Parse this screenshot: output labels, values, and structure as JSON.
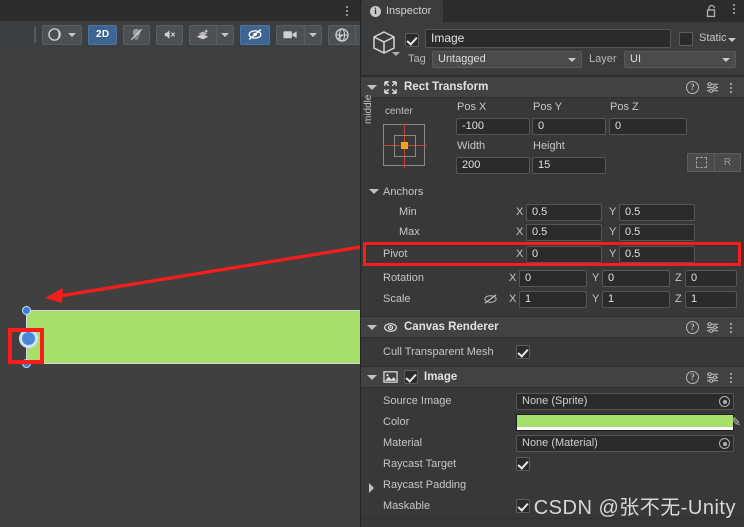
{
  "scene": {
    "tab_menu_icon": "kebab-menu-icon",
    "toolbar": {
      "draw_mode": {
        "icon": "shading-mode-icon",
        "label": "",
        "has_dropdown": true
      },
      "view_2d": {
        "label": "2D",
        "active": true
      },
      "lighting": {
        "icon": "light-off-icon",
        "active": false
      },
      "audio": {
        "icon": "audio-mute-icon",
        "active": false
      },
      "effects": {
        "icon": "fx-icon",
        "has_dropdown": true,
        "active": false
      },
      "gizmos_visibility": {
        "icon": "eye-crossed-icon",
        "active": true
      },
      "camera": {
        "icon": "camera-icon",
        "has_dropdown": true,
        "active": false
      },
      "gizmos": {
        "icon": "gizmo-globe-icon",
        "has_dropdown": true,
        "active": false
      }
    },
    "selection": {
      "rect_fill_color": "#a6e06a",
      "pivot_handle_color": "#4a87d6",
      "handle_color": "#3d7fd1",
      "annotation_color": "#fb1c1c"
    }
  },
  "inspector": {
    "tab": {
      "label": "Inspector",
      "icon": "info-icon"
    },
    "lock_icon": "lock-open-icon",
    "menu_icon": "kebab-menu-icon",
    "gameobject": {
      "icon": "prefab-cube-icon",
      "enabled": true,
      "name": "Image",
      "static_label": "Static",
      "static_checked": false,
      "tag_label": "Tag",
      "tag_value": "Untagged",
      "layer_label": "Layer",
      "layer_value": "UI"
    },
    "components": [
      {
        "title": "Rect Transform",
        "icon": "rect-transform-icon",
        "expanded": true,
        "anchor_preset": {
          "horizontal": "center",
          "vertical": "middle"
        },
        "pos": {
          "labels": [
            "Pos X",
            "Pos Y",
            "Pos Z"
          ],
          "values": [
            "-100",
            "0",
            "0"
          ]
        },
        "size": {
          "labels": [
            "Width",
            "Height"
          ],
          "values": [
            "200",
            "15"
          ]
        },
        "blueprint_button": "blueprint-mode-icon",
        "raw_button": "R",
        "anchors_label": "Anchors",
        "anchors": [
          {
            "label": "Min",
            "x": "0.5",
            "y": "0.5"
          },
          {
            "label": "Max",
            "x": "0.5",
            "y": "0.5"
          }
        ],
        "pivot": {
          "label": "Pivot",
          "x": "0",
          "y": "0.5",
          "highlighted": true
        },
        "rotation": {
          "label": "Rotation",
          "x": "0",
          "y": "0",
          "z": "0"
        },
        "scale": {
          "label": "Scale",
          "x": "1",
          "y": "1",
          "z": "1",
          "link_icon": "link-broken-icon"
        },
        "axis_labels": {
          "x": "X",
          "y": "Y",
          "z": "Z"
        }
      },
      {
        "title": "Canvas Renderer",
        "icon": "eye-icon",
        "expanded": true,
        "cull_label": "Cull Transparent Mesh",
        "cull_checked": true
      },
      {
        "title": "Image",
        "icon": "image-component-icon",
        "enabled": true,
        "expanded": true,
        "rows": [
          {
            "label": "Source Image",
            "type": "object",
            "value": "None (Sprite)"
          },
          {
            "label": "Color",
            "type": "color",
            "value": "#a6e06a"
          },
          {
            "label": "Material",
            "type": "object",
            "value": "None (Material)"
          },
          {
            "label": "Raycast Target",
            "type": "check",
            "checked": true
          },
          {
            "label": "Raycast Padding",
            "type": "foldout",
            "expanded": false
          },
          {
            "label": "Maskable",
            "type": "check",
            "checked": true
          }
        ]
      }
    ]
  },
  "watermark": {
    "text": "CSDN @张不无-Unity"
  }
}
